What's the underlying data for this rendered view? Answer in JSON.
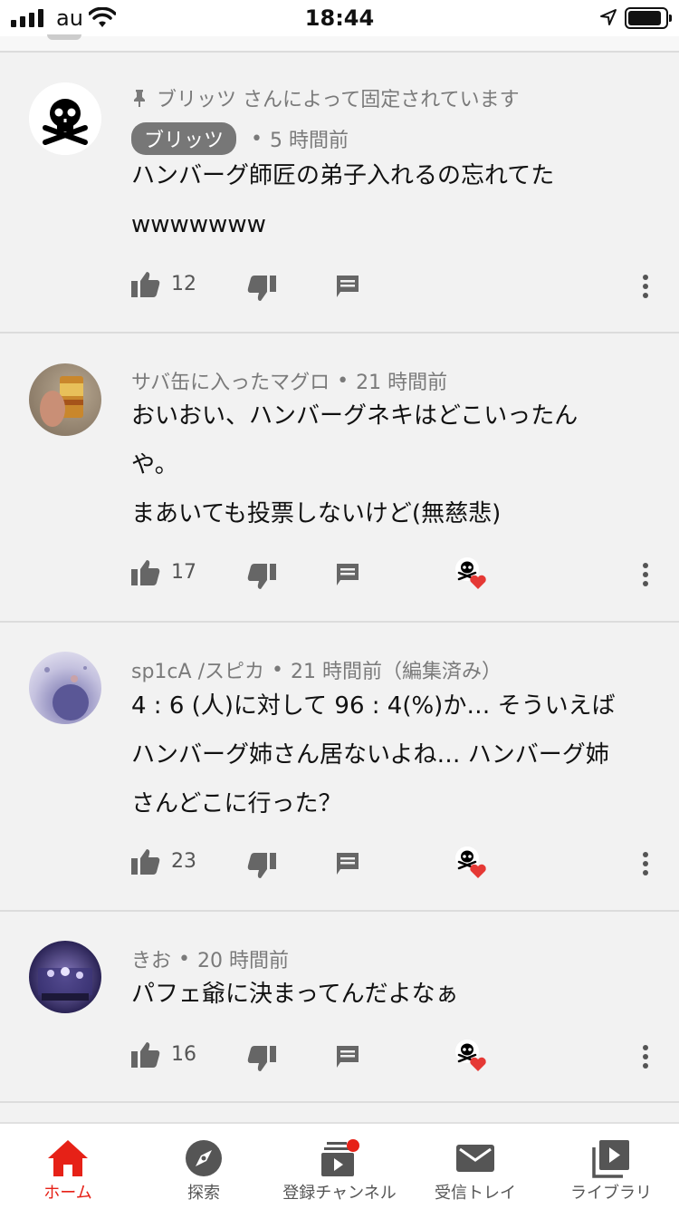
{
  "status_bar": {
    "carrier": "au",
    "time": "18:44"
  },
  "comments": [
    {
      "pinned_text": "ブリッツ さんによって固定されています",
      "author": "ブリッツ",
      "time": "5 時間前",
      "lines": [
        "ハンバーグ師匠の弟子入れるの忘れてた",
        "wwwwwww"
      ],
      "likes": "12",
      "hearted": false
    },
    {
      "author": "サバ缶に入ったマグロ",
      "time": "21 時間前",
      "lines": [
        "おいおい、ハンバーグネキはどこいったん",
        "や。",
        "まあいても投票しないけど(無慈悲)"
      ],
      "likes": "17",
      "hearted": true
    },
    {
      "author": "sp1cA /スピカ",
      "time": "21 時間前（編集済み）",
      "lines": [
        "4 : 6 (人)に対して 96 : 4(%)か…  そういえば",
        "ハンバーグ姉さん居ないよね…  ハンバーグ姉",
        "さんどこに行った？"
      ],
      "likes": "23",
      "hearted": true
    },
    {
      "author": "きお",
      "time": "20 時間前",
      "lines": [
        "パフェ爺に決まってんだよなぁ"
      ],
      "likes": "16",
      "hearted": true
    }
  ],
  "bottom_nav": [
    {
      "label": "ホーム",
      "icon": "home-icon",
      "active": true
    },
    {
      "label": "探索",
      "icon": "compass-icon",
      "active": false
    },
    {
      "label": "登録チャンネル",
      "icon": "subscriptions-icon",
      "active": false
    },
    {
      "label": "受信トレイ",
      "icon": "inbox-icon",
      "active": false
    },
    {
      "label": "ライブラリ",
      "icon": "library-icon",
      "active": false
    }
  ],
  "colors": {
    "accent": "#e62117",
    "meta_text": "#7a7a7a",
    "background": "#f2f2f2"
  }
}
